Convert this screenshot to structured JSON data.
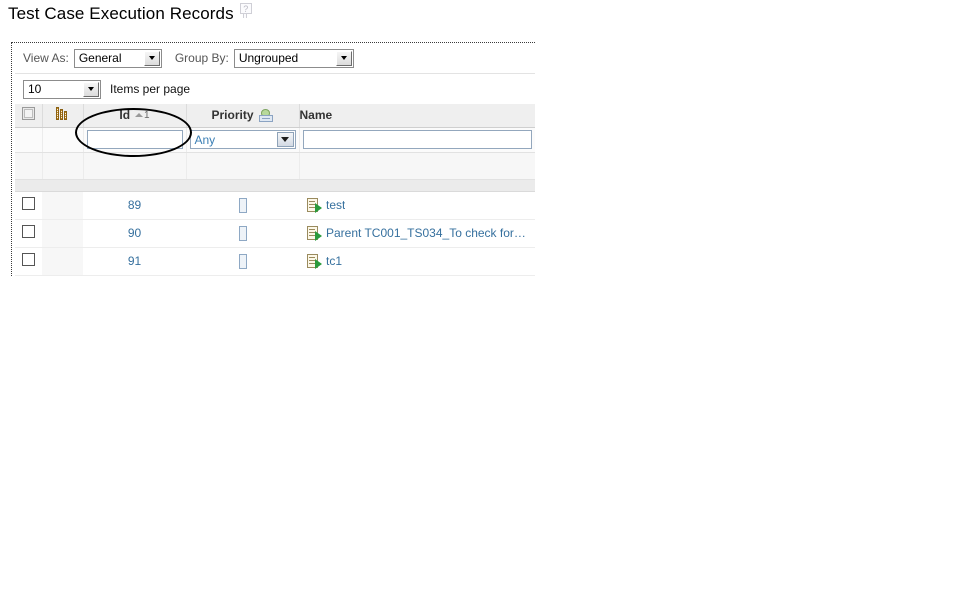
{
  "page": {
    "title": "Test Case Execution Records",
    "help_icon": "help-question-bubble-icon",
    "help_glyph": "?"
  },
  "toolbar": {
    "view_as_label": "View As:",
    "view_as_value": "General",
    "group_by_label": "Group By:",
    "group_by_value": "Ungrouped",
    "items_per_page_value": "10",
    "items_per_page_label": "Items per page"
  },
  "grid": {
    "select_all_icon": "select-all-checkbox-icon",
    "column_chooser_icon": "column-chooser-icon",
    "columns": [
      {
        "key": "check",
        "label": ""
      },
      {
        "key": "icon",
        "label": ""
      },
      {
        "key": "id",
        "label": "Id",
        "sort_direction": "asc",
        "sort_order": "1"
      },
      {
        "key": "priority",
        "label": "Priority",
        "icon": "priority-filter-icon"
      },
      {
        "key": "name",
        "label": "Name"
      }
    ],
    "filters": {
      "id_value": "",
      "id_placeholder": "",
      "priority_value": "Any",
      "name_value": "",
      "name_placeholder": ""
    },
    "rows": [
      {
        "id": "89",
        "priority": "",
        "priority_glyph": "missing-glyph-box",
        "name": "test",
        "name_icon": "test-case-run-icon"
      },
      {
        "id": "90",
        "priority": "",
        "priority_glyph": "missing-glyph-box",
        "name": "Parent TC001_TS034_To check for…",
        "name_icon": "test-case-run-icon"
      },
      {
        "id": "91",
        "priority": "",
        "priority_glyph": "missing-glyph-box",
        "name": "tc1",
        "name_icon": "test-case-run-icon"
      }
    ]
  },
  "annotation": {
    "ellipse_target": "id-column-header",
    "shape": "ellipse",
    "color": "#000000"
  },
  "colors": {
    "link": "#36709e",
    "header_bg": "#efefef",
    "band_bg": "#ebebeb",
    "filter_text": "#3b7fb5"
  }
}
